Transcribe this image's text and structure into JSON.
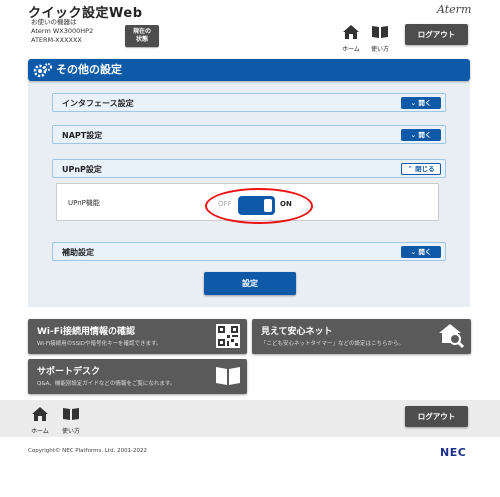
{
  "header": {
    "title": "クイック設定Web",
    "device_line1": "お使いの機器は",
    "device_line2": "Aterm  WX3000HP2",
    "device_line3": "ATERM-XXXXXX",
    "status_button_line1": "現在の",
    "status_button_line2": "状態",
    "brand": "Aterm",
    "home_label": "ホーム",
    "manual_label": "使い方",
    "logout_label": "ログアウト"
  },
  "section": {
    "title": "その他の設定"
  },
  "accordions": [
    {
      "label": "インタフェース設定",
      "button": "開く"
    },
    {
      "label": "NAPT設定",
      "button": "開く"
    },
    {
      "label": "UPnP設定",
      "button": "閉じる"
    },
    {
      "label": "補助設定",
      "button": "開く"
    }
  ],
  "upnp": {
    "field_label": "UPnP機能",
    "toggle_off": "OFF",
    "toggle_on": "ON",
    "enabled": true
  },
  "submit_label": "設定",
  "cards": [
    {
      "title": "Wi-Fi接続用情報の確認",
      "subtitle": "Wi-Fi接続用のSSIDや暗号化キーを確認できます。",
      "icon": "qr-code-icon"
    },
    {
      "title": "見えて安心ネット",
      "subtitle": "「こども安心ネットタイマー」などの設定はこちらから。",
      "icon": "house-magnifier-icon"
    },
    {
      "title": "サポートデスク",
      "subtitle": "Q&A、機能別設定ガイドなどの情報をご覧になれます。",
      "icon": "book-icon"
    }
  ],
  "footer": {
    "home_label": "ホーム",
    "manual_label": "使い方",
    "logout_label": "ログアウト",
    "copyright": "Copyright© NEC Platforms, Ltd. 2001-2022",
    "brand": "NEC"
  },
  "colors": {
    "accent": "#0f5aa8",
    "highlight": "#e11111",
    "card": "#5a5a5a"
  }
}
